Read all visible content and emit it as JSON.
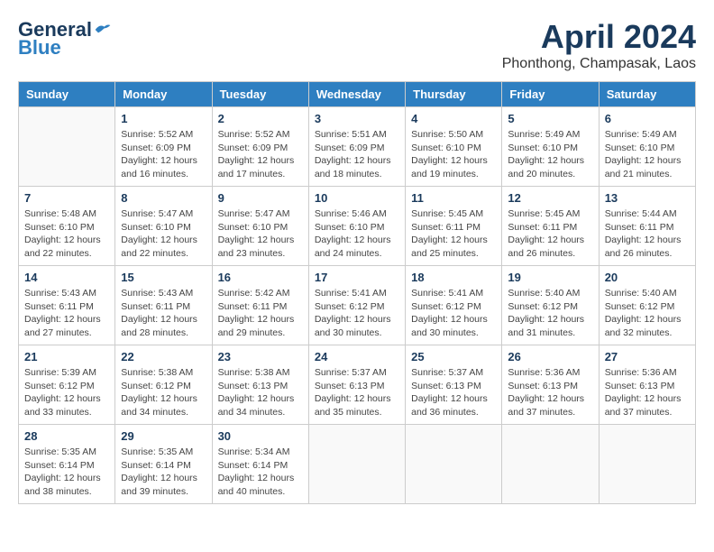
{
  "header": {
    "logo_general": "General",
    "logo_blue": "Blue",
    "month_title": "April 2024",
    "subtitle": "Phonthong, Champasak, Laos"
  },
  "columns": [
    "Sunday",
    "Monday",
    "Tuesday",
    "Wednesday",
    "Thursday",
    "Friday",
    "Saturday"
  ],
  "weeks": [
    [
      {
        "day": "",
        "info": ""
      },
      {
        "day": "1",
        "info": "Sunrise: 5:52 AM\nSunset: 6:09 PM\nDaylight: 12 hours\nand 16 minutes."
      },
      {
        "day": "2",
        "info": "Sunrise: 5:52 AM\nSunset: 6:09 PM\nDaylight: 12 hours\nand 17 minutes."
      },
      {
        "day": "3",
        "info": "Sunrise: 5:51 AM\nSunset: 6:09 PM\nDaylight: 12 hours\nand 18 minutes."
      },
      {
        "day": "4",
        "info": "Sunrise: 5:50 AM\nSunset: 6:10 PM\nDaylight: 12 hours\nand 19 minutes."
      },
      {
        "day": "5",
        "info": "Sunrise: 5:49 AM\nSunset: 6:10 PM\nDaylight: 12 hours\nand 20 minutes."
      },
      {
        "day": "6",
        "info": "Sunrise: 5:49 AM\nSunset: 6:10 PM\nDaylight: 12 hours\nand 21 minutes."
      }
    ],
    [
      {
        "day": "7",
        "info": "Sunrise: 5:48 AM\nSunset: 6:10 PM\nDaylight: 12 hours\nand 22 minutes."
      },
      {
        "day": "8",
        "info": "Sunrise: 5:47 AM\nSunset: 6:10 PM\nDaylight: 12 hours\nand 22 minutes."
      },
      {
        "day": "9",
        "info": "Sunrise: 5:47 AM\nSunset: 6:10 PM\nDaylight: 12 hours\nand 23 minutes."
      },
      {
        "day": "10",
        "info": "Sunrise: 5:46 AM\nSunset: 6:10 PM\nDaylight: 12 hours\nand 24 minutes."
      },
      {
        "day": "11",
        "info": "Sunrise: 5:45 AM\nSunset: 6:11 PM\nDaylight: 12 hours\nand 25 minutes."
      },
      {
        "day": "12",
        "info": "Sunrise: 5:45 AM\nSunset: 6:11 PM\nDaylight: 12 hours\nand 26 minutes."
      },
      {
        "day": "13",
        "info": "Sunrise: 5:44 AM\nSunset: 6:11 PM\nDaylight: 12 hours\nand 26 minutes."
      }
    ],
    [
      {
        "day": "14",
        "info": "Sunrise: 5:43 AM\nSunset: 6:11 PM\nDaylight: 12 hours\nand 27 minutes."
      },
      {
        "day": "15",
        "info": "Sunrise: 5:43 AM\nSunset: 6:11 PM\nDaylight: 12 hours\nand 28 minutes."
      },
      {
        "day": "16",
        "info": "Sunrise: 5:42 AM\nSunset: 6:11 PM\nDaylight: 12 hours\nand 29 minutes."
      },
      {
        "day": "17",
        "info": "Sunrise: 5:41 AM\nSunset: 6:12 PM\nDaylight: 12 hours\nand 30 minutes."
      },
      {
        "day": "18",
        "info": "Sunrise: 5:41 AM\nSunset: 6:12 PM\nDaylight: 12 hours\nand 30 minutes."
      },
      {
        "day": "19",
        "info": "Sunrise: 5:40 AM\nSunset: 6:12 PM\nDaylight: 12 hours\nand 31 minutes."
      },
      {
        "day": "20",
        "info": "Sunrise: 5:40 AM\nSunset: 6:12 PM\nDaylight: 12 hours\nand 32 minutes."
      }
    ],
    [
      {
        "day": "21",
        "info": "Sunrise: 5:39 AM\nSunset: 6:12 PM\nDaylight: 12 hours\nand 33 minutes."
      },
      {
        "day": "22",
        "info": "Sunrise: 5:38 AM\nSunset: 6:12 PM\nDaylight: 12 hours\nand 34 minutes."
      },
      {
        "day": "23",
        "info": "Sunrise: 5:38 AM\nSunset: 6:13 PM\nDaylight: 12 hours\nand 34 minutes."
      },
      {
        "day": "24",
        "info": "Sunrise: 5:37 AM\nSunset: 6:13 PM\nDaylight: 12 hours\nand 35 minutes."
      },
      {
        "day": "25",
        "info": "Sunrise: 5:37 AM\nSunset: 6:13 PM\nDaylight: 12 hours\nand 36 minutes."
      },
      {
        "day": "26",
        "info": "Sunrise: 5:36 AM\nSunset: 6:13 PM\nDaylight: 12 hours\nand 37 minutes."
      },
      {
        "day": "27",
        "info": "Sunrise: 5:36 AM\nSunset: 6:13 PM\nDaylight: 12 hours\nand 37 minutes."
      }
    ],
    [
      {
        "day": "28",
        "info": "Sunrise: 5:35 AM\nSunset: 6:14 PM\nDaylight: 12 hours\nand 38 minutes."
      },
      {
        "day": "29",
        "info": "Sunrise: 5:35 AM\nSunset: 6:14 PM\nDaylight: 12 hours\nand 39 minutes."
      },
      {
        "day": "30",
        "info": "Sunrise: 5:34 AM\nSunset: 6:14 PM\nDaylight: 12 hours\nand 40 minutes."
      },
      {
        "day": "",
        "info": ""
      },
      {
        "day": "",
        "info": ""
      },
      {
        "day": "",
        "info": ""
      },
      {
        "day": "",
        "info": ""
      }
    ]
  ]
}
